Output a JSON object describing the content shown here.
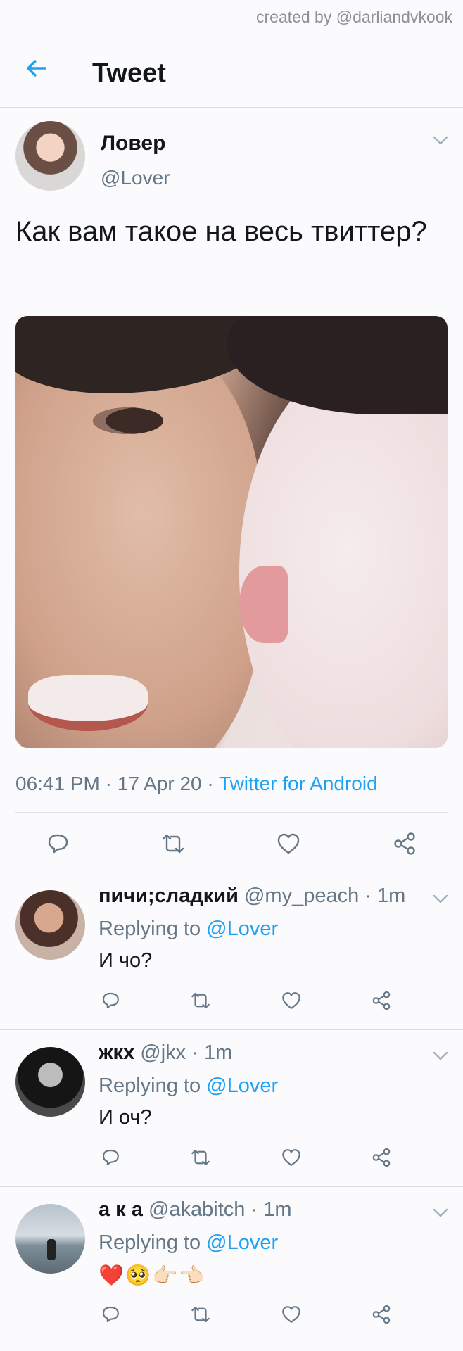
{
  "credit": "created by @darliandvkook",
  "header": {
    "title": "Tweet",
    "back_icon": "arrow-left-icon"
  },
  "tweet": {
    "author_name": "Ловер",
    "author_handle": "@Lover",
    "text": "Как вам такое на весь твиттер?",
    "time": "06:41 PM",
    "date": "17 Apr 20",
    "source": "Twitter for Android",
    "actions": [
      "reply-icon",
      "retweet-icon",
      "like-icon",
      "share-icon"
    ]
  },
  "replies": [
    {
      "name": "пичи;сладкий",
      "handle": "@my_peach",
      "age": "1m",
      "replying_prefix": "Replying to",
      "replying_to": "@Lover",
      "text": "И чо?"
    },
    {
      "name": "жкх",
      "handle": "@jkx",
      "age": "1m",
      "replying_prefix": "Replying to",
      "replying_to": "@Lover",
      "text": "И оч?"
    },
    {
      "name": "а к а",
      "handle": "@akabitch",
      "age": "1m",
      "replying_prefix": "Replying to",
      "replying_to": "@Lover",
      "text": "❤️🥺👉🏻👈🏻"
    }
  ],
  "colors": {
    "accent": "#1da1f2",
    "secondary_text": "#657786",
    "primary_text": "#14171a",
    "divider": "#e1e6ea"
  }
}
